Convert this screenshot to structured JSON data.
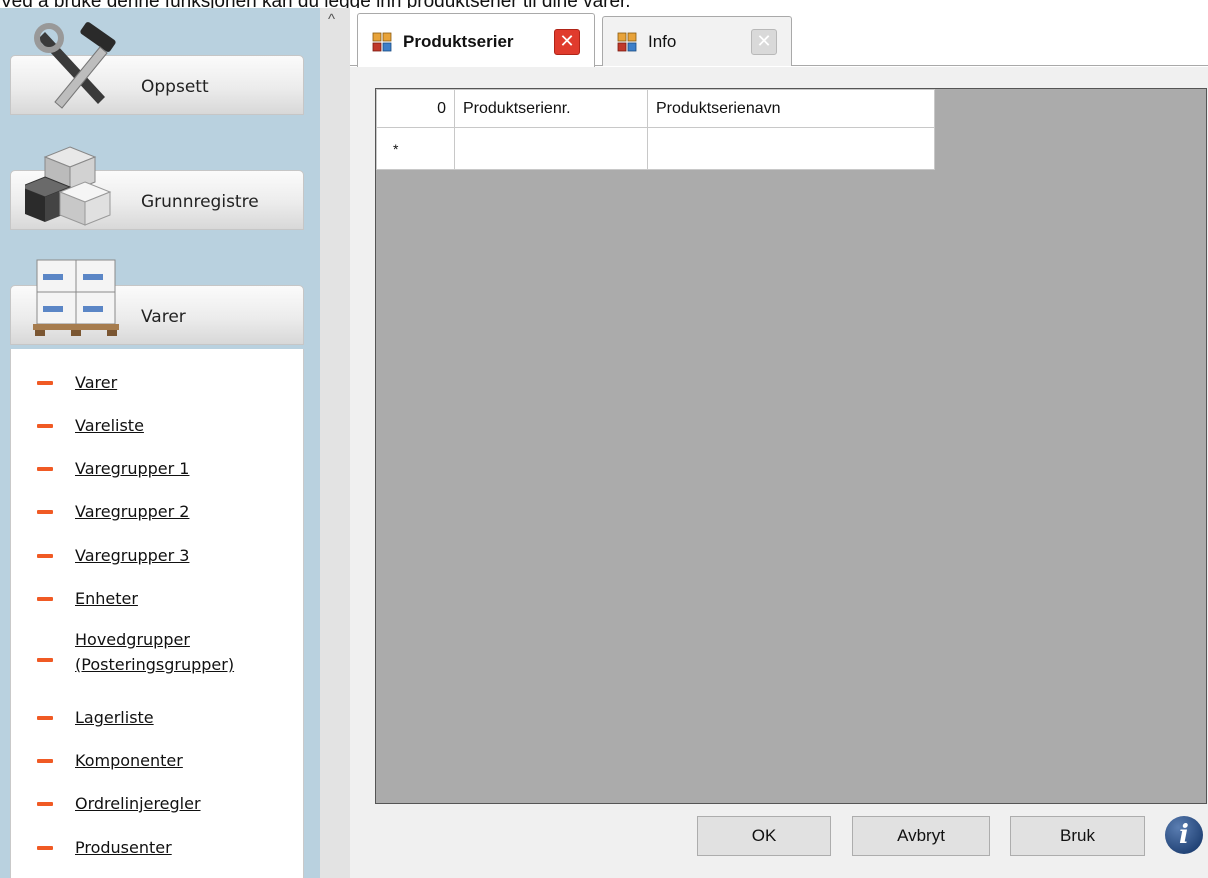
{
  "caption": "Ved å bruke denne funksjonen kan du legge inn produktserier til dine varer.",
  "nav": {
    "sections": [
      {
        "label": "Oppsett",
        "icon": "tools-icon"
      },
      {
        "label": "Grunnregistre",
        "icon": "cubes-icon"
      },
      {
        "label": "Varer",
        "icon": "pallet-boxes-icon"
      }
    ],
    "links": [
      {
        "label": "Varer"
      },
      {
        "label": "Vareliste"
      },
      {
        "label": "Varegrupper 1"
      },
      {
        "label": "Varegrupper 2"
      },
      {
        "label": "Varegrupper 3"
      },
      {
        "label": "Enheter"
      },
      {
        "label": "Hovedgrupper",
        "label2": "(Posteringsgrupper)"
      },
      {
        "label": "Lagerliste"
      },
      {
        "label": "Komponenter"
      },
      {
        "label": "Ordrelinjeregler"
      },
      {
        "label": "Produsenter"
      }
    ],
    "bullet_color": "#f05a24"
  },
  "splitter": {
    "arrow": "^"
  },
  "tabs": [
    {
      "label": "Produktserier",
      "active": true,
      "close": "✕"
    },
    {
      "label": "Info",
      "active": false,
      "close": "✕"
    }
  ],
  "grid": {
    "row_count": "0",
    "columns": [
      "Produktserienr.",
      "Produktserienavn"
    ],
    "new_row_marker": "*"
  },
  "buttons": {
    "ok": "OK",
    "cancel": "Avbryt",
    "apply": "Bruk",
    "info": "i"
  },
  "colors": {
    "nav_bg": "#b9d1df",
    "grid_bg": "#ababab",
    "close_active": "#e03b2d"
  }
}
